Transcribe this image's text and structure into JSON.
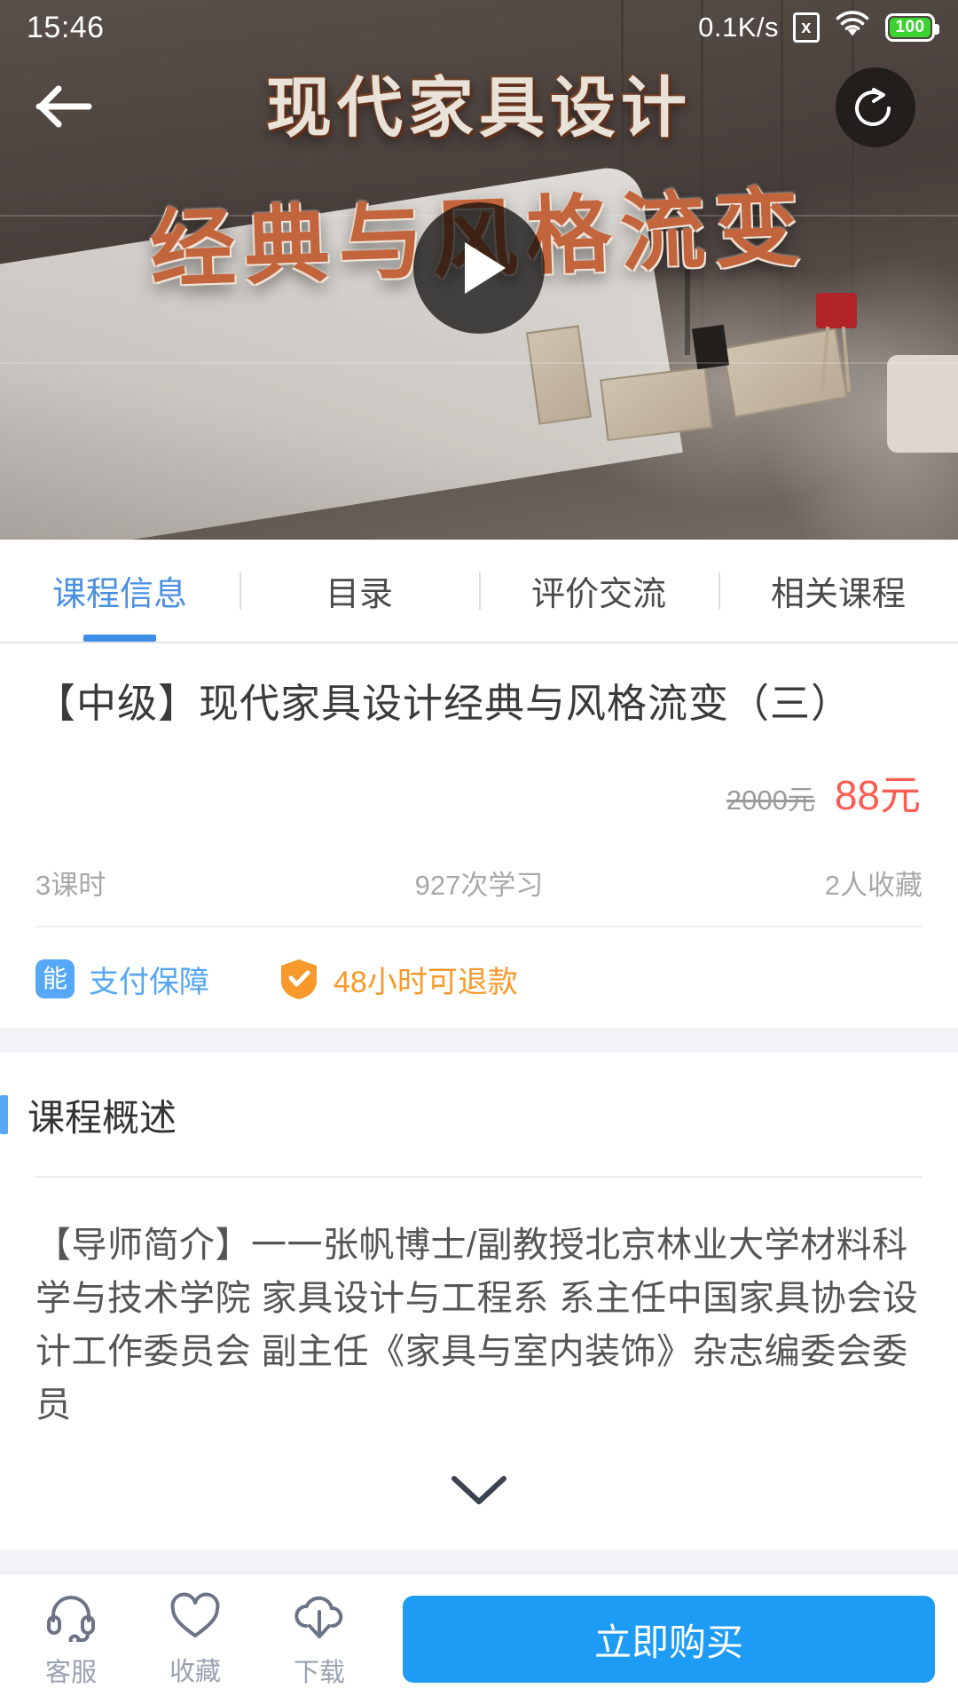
{
  "status_bar": {
    "time": "15:46",
    "network_speed": "0.1K/s",
    "sim_icon": "sim-x-icon",
    "sim_label": "x",
    "wifi_icon": "wifi-icon",
    "battery_icon": "battery-icon",
    "battery_level": "100"
  },
  "hero": {
    "back_icon": "back-arrow-icon",
    "share_icon": "share-icon",
    "play_icon": "play-icon",
    "title_line1": "现代家具设计",
    "title_line2": "经典与风格流变"
  },
  "tabs": [
    {
      "label": "课程信息",
      "active": true
    },
    {
      "label": "目录",
      "active": false
    },
    {
      "label": "评价交流",
      "active": false
    },
    {
      "label": "相关课程",
      "active": false
    }
  ],
  "course": {
    "title": "【中级】现代家具设计经典与风格流变（三）",
    "price_original": "2000元",
    "price_current": "88元",
    "stats": [
      "3课时",
      "927次学习",
      "2人收藏"
    ],
    "guarantees": [
      {
        "badge": "能",
        "text": "支付保障",
        "icon": "pay-guarantee-icon"
      },
      {
        "badge": "",
        "text": "48小时可退款",
        "icon": "shield-check-icon"
      }
    ]
  },
  "overview": {
    "section_title": "课程概述",
    "description": "【导师简介】一一张帆博士/副教授北京林业大学材料科学与技术学院 家具设计与工程系 系主任中国家具协会设计工作委员会 副主任《家具与室内装饰》杂志编委会委员",
    "expand_icon": "chevron-down-icon"
  },
  "bottom_bar": {
    "actions": [
      {
        "label": "客服",
        "icon": "headset-icon"
      },
      {
        "label": "收藏",
        "icon": "heart-icon"
      },
      {
        "label": "下载",
        "icon": "cloud-download-icon"
      }
    ],
    "buy_label": "立即购买"
  },
  "colors": {
    "accent_blue": "#1e9bf5",
    "tab_active": "#4a90e2",
    "price_red": "#fb5c52",
    "guarantee_orange": "#f79a2b",
    "guarantee_blue": "#56a7f5"
  }
}
